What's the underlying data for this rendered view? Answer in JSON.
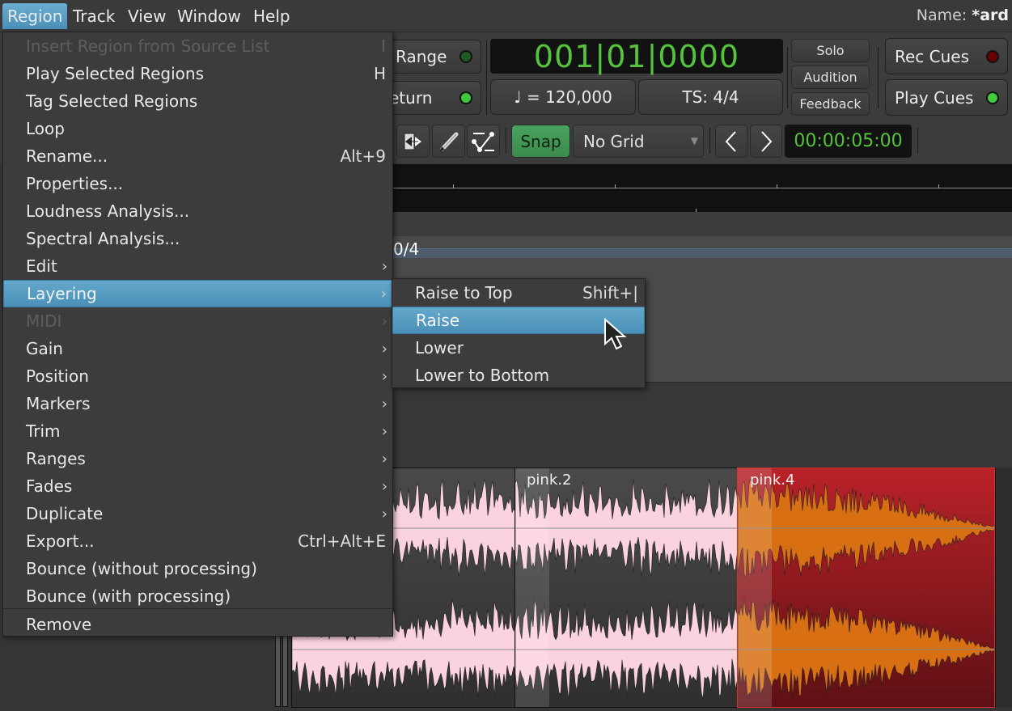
{
  "menubar": {
    "items": [
      "Region",
      "Track",
      "View",
      "Window",
      "Help"
    ],
    "active": "Region",
    "name_label": "Name:",
    "name_value": "*ard"
  },
  "transport": {
    "range_label": "Range",
    "return_label": "eturn",
    "primary_clock": "001|01|0000",
    "tempo": "♩ = 120,000",
    "time_signature": "TS: 4/4",
    "solo_label": "Solo",
    "audition_label": "Audition",
    "feedback_label": "Feedback",
    "rec_cues_label": "Rec Cues",
    "play_cues_label": "Play Cues"
  },
  "edit_toolbar": {
    "snap_label": "Snap",
    "grid_select": "No Grid",
    "nudge_clock": "00:00:05:00"
  },
  "rulers": {
    "meter_text": "0/4"
  },
  "regions": [
    {
      "name": "",
      "color": "pink"
    },
    {
      "name": "pink.2",
      "color": "pink"
    },
    {
      "name": "pink.4",
      "color": "selected"
    }
  ],
  "region_menu": {
    "items": [
      {
        "label": "Insert Region from Source List",
        "accel": "I",
        "disabled": true
      },
      {
        "label": "Play Selected Regions",
        "accel": "H"
      },
      {
        "label": "Tag Selected Regions",
        "accel": ""
      },
      {
        "label": "Loop",
        "accel": ""
      },
      {
        "label": "Rename...",
        "accel": "Alt+9"
      },
      {
        "label": "Properties...",
        "accel": ""
      },
      {
        "label": "Loudness Analysis...",
        "accel": ""
      },
      {
        "label": "Spectral Analysis...",
        "accel": ""
      },
      {
        "label": "Edit",
        "submenu": true
      },
      {
        "label": "Layering",
        "submenu": true,
        "highlighted": true
      },
      {
        "label": "MIDI",
        "submenu": true,
        "disabled": true
      },
      {
        "label": "Gain",
        "submenu": true
      },
      {
        "label": "Position",
        "submenu": true
      },
      {
        "label": "Markers",
        "submenu": true
      },
      {
        "label": "Trim",
        "submenu": true
      },
      {
        "label": "Ranges",
        "submenu": true
      },
      {
        "label": "Fades",
        "submenu": true
      },
      {
        "label": "Duplicate",
        "submenu": true
      },
      {
        "label": "Export...",
        "accel": "Ctrl+Alt+E"
      },
      {
        "label": "Bounce (without processing)",
        "accel": ""
      },
      {
        "label": "Bounce (with processing)",
        "accel": ""
      },
      {
        "label": "Remove",
        "accel": ""
      }
    ]
  },
  "layering_submenu": {
    "items": [
      {
        "label": "Raise to Top",
        "accel": "Shift+|"
      },
      {
        "label": "Raise",
        "accel": "",
        "highlighted": true
      },
      {
        "label": "Lower",
        "accel": ""
      },
      {
        "label": "Lower to Bottom",
        "accel": ""
      }
    ]
  },
  "colors": {
    "accent": "#4a90b8",
    "clock_green": "#55c43c",
    "snap_green": "#3d8f4f",
    "region_pink": "#fbd3de",
    "region_selected": "#9e1a1a",
    "waveform_selected": "#d86f12",
    "led_green": "#3ec93e",
    "led_red": "#6a0000"
  }
}
